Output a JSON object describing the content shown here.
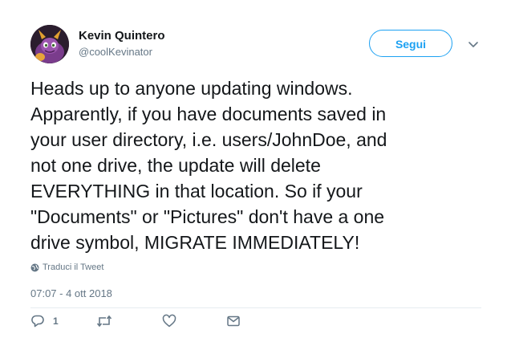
{
  "user": {
    "name": "Kevin Quintero",
    "handle": "@coolKevinator"
  },
  "follow_label": "Segui",
  "tweet": {
    "lines": [
      "Heads up to anyone updating windows.",
      "Apparently, if you have documents saved in",
      "your user directory, i.e. users/JohnDoe, and",
      "not one drive, the update will delete",
      "EVERYTHING in that location. So if your",
      "\"Documents\" or \"Pictures\" don't have a one",
      "drive symbol, MIGRATE IMMEDIATELY!"
    ]
  },
  "translate_label": "Traduci il Tweet",
  "timestamp": "07:07 - 4 ott 2018",
  "actions": {
    "reply_count": "1"
  },
  "icons": {
    "reply": "reply-icon",
    "retweet": "retweet-icon",
    "like": "heart-icon",
    "dm": "envelope-icon",
    "caret": "chevron-down-icon",
    "globe": "globe-icon"
  },
  "colors": {
    "accent": "#1da1f2",
    "text": "#14171a",
    "muted": "#657786",
    "divider": "#e6ecf0"
  }
}
